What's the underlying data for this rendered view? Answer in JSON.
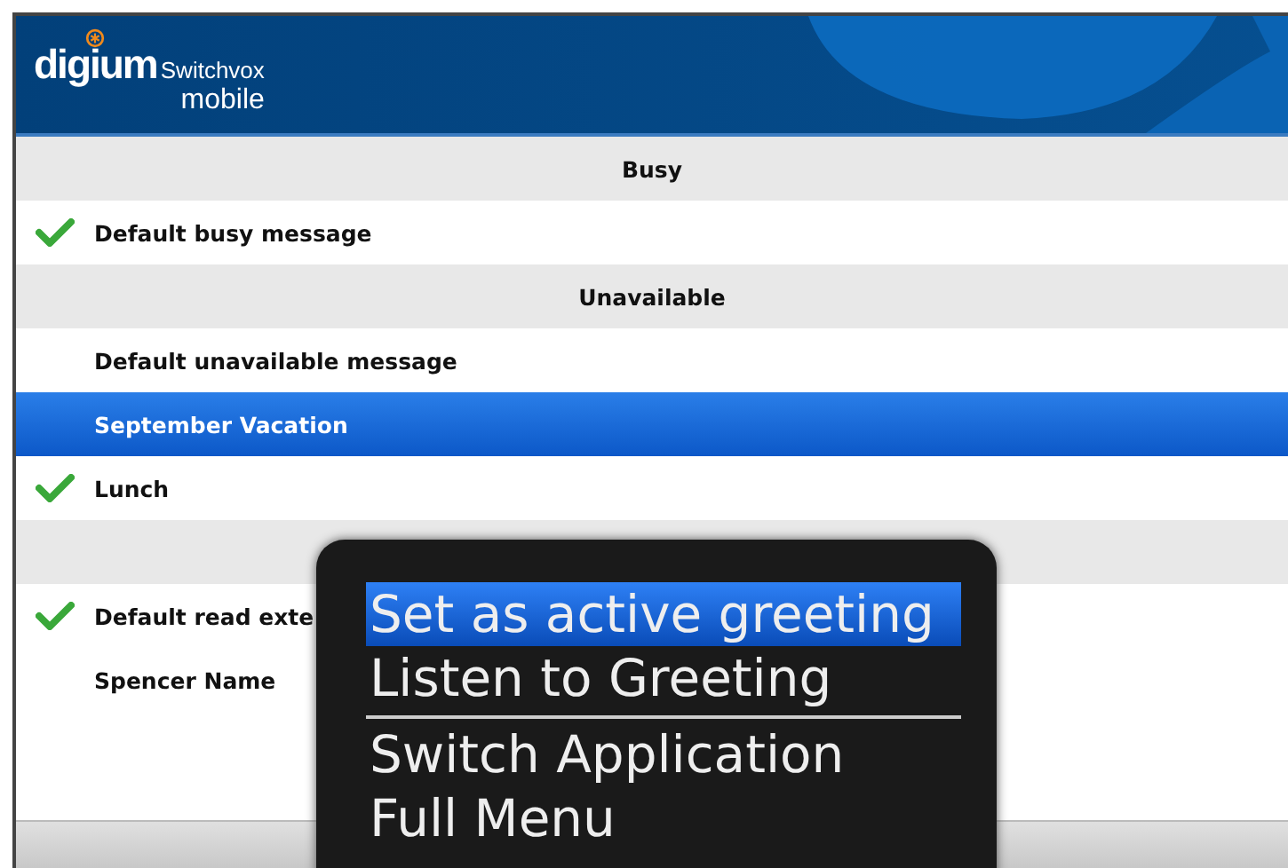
{
  "header": {
    "brand": "digium",
    "product": "Switchvox",
    "subtitle": "mobile"
  },
  "rows": [
    {
      "kind": "header",
      "label": "Busy"
    },
    {
      "kind": "greeting",
      "label": "Default busy message",
      "active": true,
      "selected": false
    },
    {
      "kind": "header",
      "label": "Unavailable"
    },
    {
      "kind": "greeting",
      "label": "Default unavailable message",
      "active": false,
      "selected": false
    },
    {
      "kind": "greeting",
      "label": "September Vacation",
      "active": false,
      "selected": true
    },
    {
      "kind": "greeting",
      "label": "Lunch",
      "active": true,
      "selected": false
    },
    {
      "kind": "header"
    },
    {
      "kind": "greeting",
      "label": "Default read exte",
      "active": true,
      "selected": false
    },
    {
      "kind": "greeting",
      "label": "Spencer Name",
      "active": false,
      "selected": false
    }
  ],
  "menu": [
    {
      "label": "Set as active greeting",
      "selected": true
    },
    {
      "label": "Listen to Greeting",
      "selected": false,
      "divider_after": true
    },
    {
      "label": "Switch Application",
      "selected": false
    },
    {
      "label": "Full Menu",
      "selected": false
    }
  ]
}
